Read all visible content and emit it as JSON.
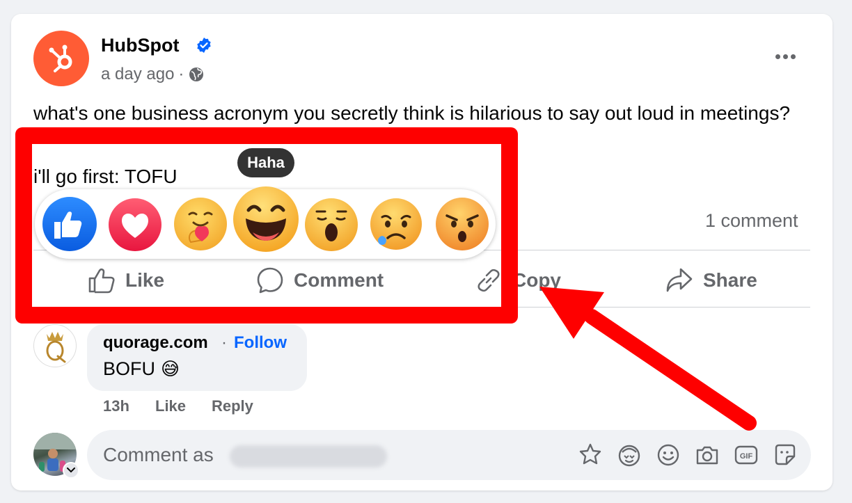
{
  "post": {
    "page_name": "HubSpot",
    "time": "a day ago",
    "separator": "·",
    "text_line1": "what's one business acronym you secretly think is hilarious to say out loud in meetings?",
    "text_line2": "i'll go first: TOFU",
    "comment_count": "1 comment"
  },
  "actions": {
    "like": "Like",
    "comment": "Comment",
    "copy": "Copy",
    "share": "Share"
  },
  "reactions": {
    "tooltip": "Haha",
    "items": [
      "like-reaction",
      "love-reaction",
      "care-reaction",
      "haha-reaction",
      "wow-reaction",
      "sad-reaction",
      "angry-reaction"
    ]
  },
  "comment": {
    "author": "quorage.com",
    "dot": "·",
    "follow": "Follow",
    "text": "BOFU",
    "emoji": "😅",
    "time": "13h",
    "like": "Like",
    "reply": "Reply"
  },
  "composer": {
    "placeholder": "Comment as"
  },
  "colors": {
    "hubspot": "#ff5c35",
    "highlight": "#fe0000",
    "link": "#0866ff",
    "like_blue": "#1877f2"
  }
}
